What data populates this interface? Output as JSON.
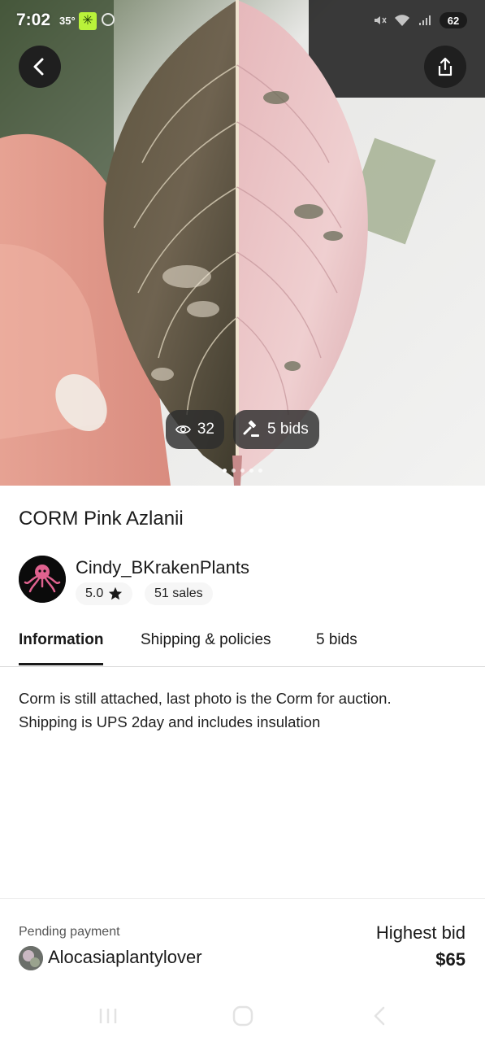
{
  "status_bar": {
    "time": "7:02",
    "temperature": "35°",
    "battery": "62"
  },
  "hero": {
    "views_count": "32",
    "bids_label": "5 bids",
    "carousel_dots": 5,
    "carousel_active_index": 0
  },
  "listing": {
    "title": "CORM Pink Azlanii",
    "description_lines": [
      "Corm is still attached, last photo is the Corm for auction.",
      "Shipping is UPS 2day and includes insulation"
    ]
  },
  "seller": {
    "name": "Cindy_BKrakenPlants",
    "rating": "5.0",
    "sales": "51 sales",
    "avatar_text": "BLACK KRAKEN"
  },
  "tabs": {
    "information": "Information",
    "shipping": "Shipping & policies",
    "bids": "5 bids",
    "active": "information"
  },
  "footer": {
    "pending_label": "Pending payment",
    "buyer_name": "Alocasiaplantylover",
    "highest_bid_label": "Highest bid",
    "highest_bid_value": "$65"
  },
  "icons": {
    "back": "chevron-left-icon",
    "share": "share-icon",
    "views": "eye-icon",
    "bids": "gavel-icon",
    "rating": "star-icon",
    "nav_recents": "recents-icon",
    "nav_home": "home-icon",
    "nav_back": "back-nav-icon"
  },
  "colors": {
    "accent_dark": "#1f1f1f",
    "weather_icon_bg": "#b9f23a"
  }
}
